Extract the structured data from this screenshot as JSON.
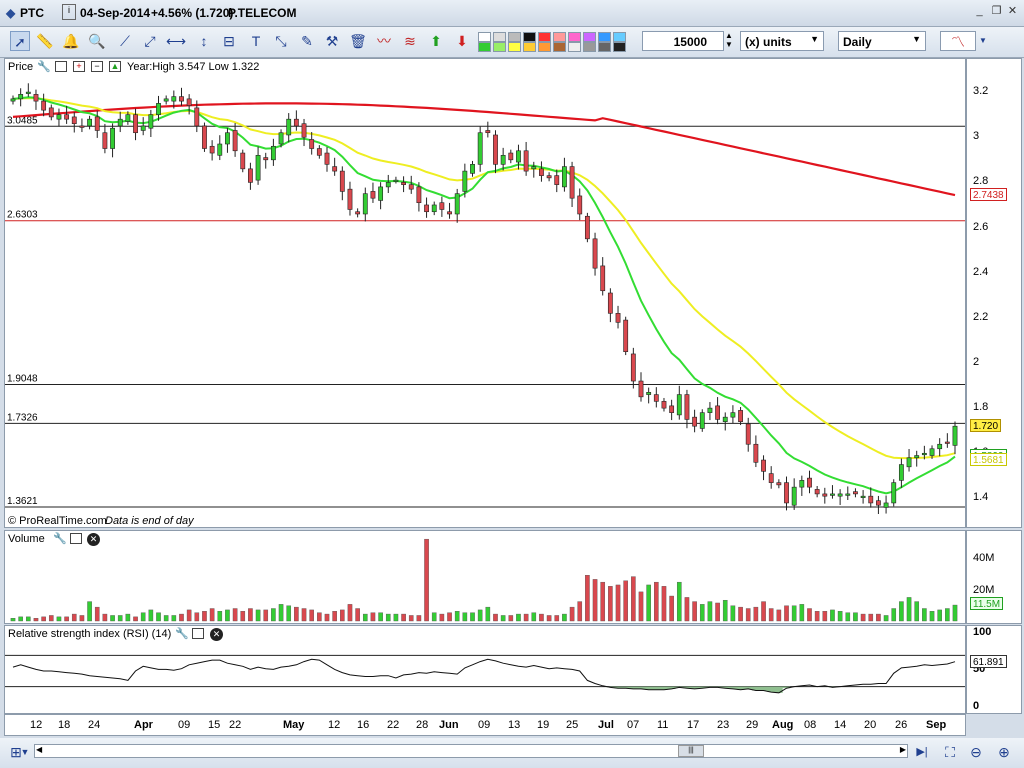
{
  "window": {
    "symbol": "PTC",
    "date": "04-Sep-2014",
    "change": "+4.56% (1.720)",
    "name": "P.TELECOM"
  },
  "toolbar": {
    "quantity": "15000",
    "units_label": "(x) units",
    "period": "Daily",
    "icons": [
      "pointer-icon",
      "ruler-icon",
      "alarm-icon",
      "zoom-icon",
      "trendline-icon",
      "ray-icon",
      "horizontal-line-icon",
      "vertical-line-icon",
      "channel-icon",
      "text-icon",
      "arrow-icon",
      "pencil-icon",
      "tools-icon",
      "trash-icon",
      "indicator-icon",
      "fibonacci-icon",
      "triangle-icon",
      "buy-arrow-icon",
      "sell-arrow-icon"
    ]
  },
  "price_panel": {
    "title": "Price",
    "info": "Year:High 3.547 Low 1.322",
    "copyright": "© ProRealTime.com",
    "notice": "Data is end of day",
    "yticks": [
      "3.2",
      "3",
      "2.8",
      "2.6",
      "2.4",
      "2.2",
      "2",
      "1.8",
      "1.6",
      "1.4"
    ],
    "hlines": [
      "3.0485",
      "2.6303",
      "1.9048",
      "1.7326",
      "1.3621"
    ],
    "tags": {
      "ma200": "2.7438",
      "last": "1.720",
      "ma_green": "1.5899",
      "ma_yellow": "1.5681"
    }
  },
  "volume_panel": {
    "title": "Volume",
    "yticks": [
      "40M",
      "20M"
    ],
    "tag": "11.5M"
  },
  "rsi_panel": {
    "title": "Relative strength index (RSI) (14)",
    "yticks": [
      "100",
      "50",
      "0"
    ],
    "tag": "61.891"
  },
  "xaxis": {
    "labels": [
      "12",
      "18",
      "24",
      "Apr",
      "09",
      "15",
      "22",
      "May",
      "12",
      "16",
      "22",
      "28",
      "Jun",
      "09",
      "13",
      "19",
      "25",
      "Jul",
      "07",
      "11",
      "17",
      "23",
      "29",
      "Aug",
      "08",
      "14",
      "20",
      "26",
      "Sep"
    ]
  },
  "colors": {
    "up": "#33cc33",
    "down": "#d9484e",
    "ma200": "#e0141e",
    "ma_fast": "#33dd33",
    "ma_slow": "#eeee22"
  },
  "chart_data": {
    "type": "candlestick",
    "x": [
      "2014-03-12",
      "2014-03-13",
      "2014-03-14",
      "2014-03-17",
      "2014-03-18",
      "2014-03-19",
      "2014-03-20",
      "2014-03-21",
      "2014-03-24",
      "2014-03-25",
      "2014-03-26",
      "2014-03-27",
      "2014-03-28",
      "2014-03-31",
      "2014-04-01",
      "2014-04-02",
      "2014-04-03",
      "2014-04-04",
      "2014-04-07",
      "2014-04-08",
      "2014-04-09",
      "2014-04-10",
      "2014-04-11",
      "2014-04-14",
      "2014-04-15",
      "2014-04-16",
      "2014-04-17",
      "2014-04-22",
      "2014-04-23",
      "2014-04-24",
      "2014-04-25",
      "2014-04-28",
      "2014-04-29",
      "2014-04-30",
      "2014-05-02",
      "2014-05-05",
      "2014-05-06",
      "2014-05-07",
      "2014-05-08",
      "2014-05-09",
      "2014-05-12",
      "2014-05-13",
      "2014-05-14",
      "2014-05-15",
      "2014-05-16",
      "2014-05-19",
      "2014-05-20",
      "2014-05-21",
      "2014-05-22",
      "2014-05-23",
      "2014-05-26",
      "2014-05-27",
      "2014-05-28",
      "2014-05-29",
      "2014-05-30",
      "2014-06-02",
      "2014-06-03",
      "2014-06-04",
      "2014-06-05",
      "2014-06-06",
      "2014-06-09",
      "2014-06-10",
      "2014-06-11",
      "2014-06-12",
      "2014-06-13",
      "2014-06-16",
      "2014-06-17",
      "2014-06-18",
      "2014-06-19",
      "2014-06-20",
      "2014-06-23",
      "2014-06-24",
      "2014-06-25",
      "2014-06-26",
      "2014-06-27",
      "2014-06-30",
      "2014-07-01",
      "2014-07-02",
      "2014-07-03",
      "2014-07-04",
      "2014-07-07",
      "2014-07-08",
      "2014-07-09",
      "2014-07-10",
      "2014-07-11",
      "2014-07-14",
      "2014-07-15",
      "2014-07-16",
      "2014-07-17",
      "2014-07-18",
      "2014-07-21",
      "2014-07-22",
      "2014-07-23",
      "2014-07-24",
      "2014-07-25",
      "2014-07-28",
      "2014-07-29",
      "2014-07-30",
      "2014-07-31",
      "2014-08-01",
      "2014-08-04",
      "2014-08-05",
      "2014-08-06",
      "2014-08-07",
      "2014-08-08",
      "2014-08-11",
      "2014-08-12",
      "2014-08-13",
      "2014-08-14",
      "2014-08-15",
      "2014-08-18",
      "2014-08-19",
      "2014-08-20",
      "2014-08-21",
      "2014-08-22",
      "2014-08-25",
      "2014-08-26",
      "2014-08-27",
      "2014-08-28",
      "2014-08-29",
      "2014-09-01",
      "2014-09-02",
      "2014-09-03",
      "2014-09-04"
    ],
    "close": [
      3.17,
      3.19,
      3.2,
      3.16,
      3.12,
      3.09,
      3.1,
      3.08,
      3.06,
      3.05,
      3.08,
      3.03,
      2.95,
      3.04,
      3.08,
      3.1,
      3.02,
      3.05,
      3.1,
      3.15,
      3.17,
      3.18,
      3.16,
      3.14,
      3.05,
      2.95,
      2.93,
      2.97,
      3.02,
      2.94,
      2.86,
      2.8,
      2.92,
      2.9,
      2.96,
      3.02,
      3.08,
      3.05,
      3.0,
      2.95,
      2.92,
      2.88,
      2.85,
      2.76,
      2.68,
      2.66,
      2.75,
      2.73,
      2.78,
      2.8,
      2.81,
      2.79,
      2.77,
      2.71,
      2.67,
      2.7,
      2.68,
      2.66,
      2.75,
      2.85,
      2.88,
      3.02,
      3.02,
      2.88,
      2.92,
      2.9,
      2.94,
      2.85,
      2.87,
      2.83,
      2.82,
      2.79,
      2.87,
      2.73,
      2.66,
      2.55,
      2.42,
      2.32,
      2.22,
      2.18,
      2.05,
      1.92,
      1.85,
      1.87,
      1.83,
      1.8,
      1.78,
      1.86,
      1.75,
      1.72,
      1.78,
      1.8,
      1.75,
      1.76,
      1.78,
      1.74,
      1.64,
      1.56,
      1.52,
      1.47,
      1.46,
      1.38,
      1.45,
      1.48,
      1.45,
      1.42,
      1.41,
      1.42,
      1.42,
      1.42,
      1.42,
      1.41,
      1.38,
      1.37,
      1.38,
      1.47,
      1.55,
      1.58,
      1.59,
      1.6,
      1.62,
      1.64,
      1.645,
      1.72
    ],
    "ma_fast": {
      "start": 3.13,
      "end": 1.59
    },
    "ma_slow": {
      "start": 3.16,
      "end": 1.568
    },
    "ma200": {
      "start": 3.11,
      "end": 2.7438
    },
    "volume_millions": [
      2,
      3,
      3,
      2,
      3,
      4,
      3,
      3,
      5,
      4,
      14,
      10,
      5,
      4,
      4,
      5,
      3,
      6,
      8,
      6,
      4,
      4,
      5,
      8,
      6,
      7,
      9,
      7,
      8,
      9,
      7,
      9,
      8,
      8,
      9,
      12,
      11,
      10,
      9,
      8,
      6,
      5,
      7,
      8,
      12,
      9,
      5,
      6,
      6,
      5,
      5,
      5,
      4,
      4,
      59,
      6,
      5,
      6,
      7,
      6,
      6,
      8,
      10,
      5,
      4,
      4,
      5,
      5,
      6,
      5,
      4,
      4,
      5,
      10,
      14,
      33,
      30,
      28,
      25,
      26,
      29,
      32,
      21,
      26,
      28,
      25,
      18,
      28,
      17,
      14,
      12,
      14,
      13,
      15,
      11,
      10,
      9,
      10,
      14,
      9,
      8,
      11,
      11,
      12,
      9,
      7,
      7,
      8,
      7,
      6,
      6,
      5,
      5,
      5,
      4,
      9,
      14,
      17,
      14,
      9,
      7,
      8,
      9,
      11.5
    ],
    "rsi": [
      55,
      58,
      55,
      52,
      50,
      50,
      49,
      48,
      47,
      46,
      44,
      43,
      42,
      41,
      40,
      38,
      50,
      56,
      54,
      52,
      52,
      51,
      53,
      58,
      60,
      62,
      64,
      64,
      60,
      58,
      56,
      52,
      55,
      53,
      52,
      55,
      56,
      58,
      62,
      65,
      64,
      58,
      52,
      48,
      45,
      44,
      43,
      43,
      44,
      44,
      41,
      45,
      46,
      48,
      47,
      49,
      48,
      47,
      46,
      54,
      58,
      62,
      65,
      63,
      60,
      58,
      56,
      55,
      57,
      55,
      53,
      54,
      53,
      52,
      50,
      38,
      34,
      31,
      29,
      28,
      28,
      27,
      27,
      26,
      26,
      26,
      27,
      29,
      28,
      27,
      28,
      29,
      29,
      28,
      27,
      26,
      27,
      25,
      25,
      23,
      22,
      28,
      30,
      31,
      32,
      30,
      31,
      29,
      30,
      31,
      32,
      33,
      33,
      34,
      34,
      47,
      54,
      55,
      56,
      58,
      57,
      58,
      59,
      61.891
    ],
    "yrange_price": [
      1.3,
      3.32
    ],
    "horizontal_lines": [
      3.0485,
      2.6303,
      1.9048,
      1.7326,
      1.3621
    ]
  }
}
